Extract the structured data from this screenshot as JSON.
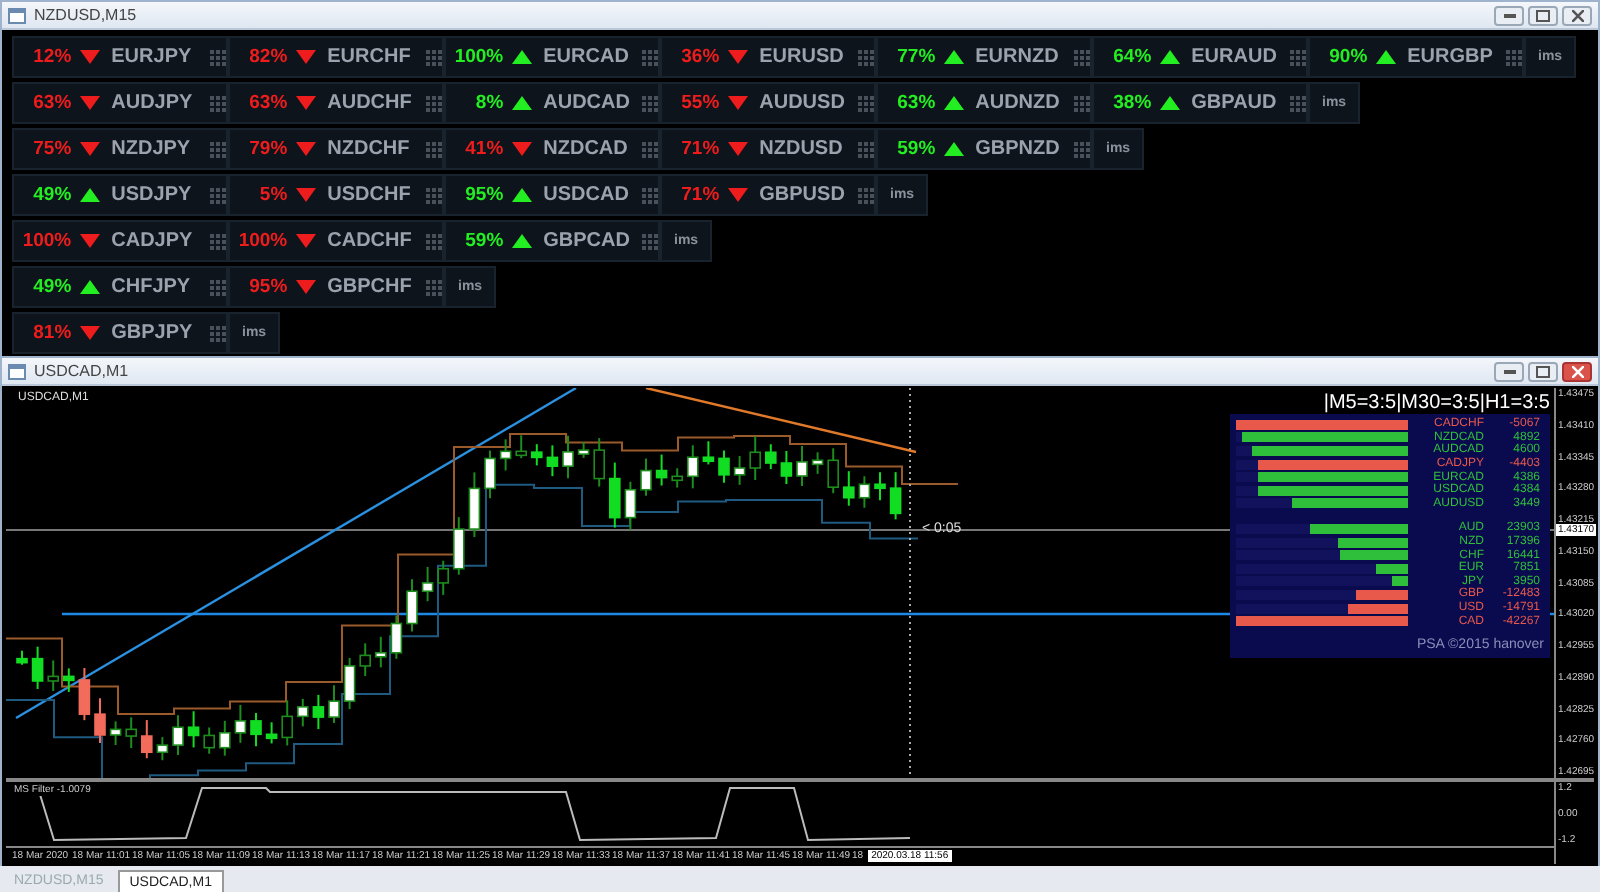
{
  "heatmap_window": {
    "title": "NZDUSD,M15",
    "rows": [
      {
        "tiles": [
          {
            "percent": "12%",
            "rising": false,
            "pair": "EURJPY"
          },
          {
            "percent": "82%",
            "rising": false,
            "pair": "EURCHF"
          },
          {
            "percent": "100%",
            "rising": true,
            "pair": "EURCAD"
          },
          {
            "percent": "36%",
            "rising": false,
            "pair": "EURUSD"
          },
          {
            "percent": "77%",
            "rising": true,
            "pair": "EURNZD"
          },
          {
            "percent": "64%",
            "rising": true,
            "pair": "EURAUD"
          },
          {
            "percent": "90%",
            "rising": true,
            "pair": "EURGBP"
          }
        ],
        "logo": "ims"
      },
      {
        "tiles": [
          {
            "percent": "63%",
            "rising": false,
            "pair": "AUDJPY"
          },
          {
            "percent": "63%",
            "rising": false,
            "pair": "AUDCHF"
          },
          {
            "percent": "8%",
            "rising": true,
            "pair": "AUDCAD"
          },
          {
            "percent": "55%",
            "rising": false,
            "pair": "AUDUSD"
          },
          {
            "percent": "63%",
            "rising": true,
            "pair": "AUDNZD"
          },
          {
            "percent": "38%",
            "rising": true,
            "pair": "GBPAUD"
          }
        ],
        "logo": "ims"
      },
      {
        "tiles": [
          {
            "percent": "75%",
            "rising": false,
            "pair": "NZDJPY"
          },
          {
            "percent": "79%",
            "rising": false,
            "pair": "NZDCHF"
          },
          {
            "percent": "41%",
            "rising": false,
            "pair": "NZDCAD"
          },
          {
            "percent": "71%",
            "rising": false,
            "pair": "NZDUSD"
          },
          {
            "percent": "59%",
            "rising": true,
            "pair": "GBPNZD"
          }
        ],
        "logo": "ims"
      },
      {
        "tiles": [
          {
            "percent": "49%",
            "rising": true,
            "pair": "USDJPY"
          },
          {
            "percent": "5%",
            "rising": false,
            "pair": "USDCHF"
          },
          {
            "percent": "95%",
            "rising": true,
            "pair": "USDCAD"
          },
          {
            "percent": "71%",
            "rising": false,
            "pair": "GBPUSD"
          }
        ],
        "logo": "ims"
      },
      {
        "tiles": [
          {
            "percent": "100%",
            "rising": false,
            "pair": "CADJPY"
          },
          {
            "percent": "100%",
            "rising": false,
            "pair": "CADCHF"
          },
          {
            "percent": "59%",
            "rising": true,
            "pair": "GBPCAD"
          }
        ],
        "logo": "ims"
      },
      {
        "tiles": [
          {
            "percent": "49%",
            "rising": true,
            "pair": "CHFJPY"
          },
          {
            "percent": "95%",
            "rising": false,
            "pair": "GBPCHF"
          }
        ],
        "logo": "ims"
      },
      {
        "tiles": [
          {
            "percent": "81%",
            "rising": false,
            "pair": "GBPJPY"
          }
        ],
        "logo": "ims"
      }
    ]
  },
  "chart_window": {
    "title": "USDCAD,M1",
    "symbol_label": "USDCAD,M1",
    "timer": "< 0:05",
    "price_axis": [
      "1.43475",
      "1.43410",
      "1.43345",
      "1.43280",
      "1.43215",
      "1.43150",
      "1.43085",
      "1.43020",
      "1.42955",
      "1.42890",
      "1.42825",
      "1.42760",
      "1.42695"
    ],
    "current_price": "1.43170",
    "strength_panel": {
      "title": "|M5=3:5|M30=3:5|H1=3:5",
      "pairs": [
        {
          "name": "CADCHF",
          "value": "-5067",
          "level": 1,
          "color": "#e8594b"
        },
        {
          "name": "NZDCAD",
          "value": "4892",
          "level": 0.97,
          "color": "#2fbf3a"
        },
        {
          "name": "AUDCAD",
          "value": "4600",
          "level": 0.91,
          "color": "#2fbf3a"
        },
        {
          "name": "CADJPY",
          "value": "-4403",
          "level": 0.87,
          "color": "#e8594b"
        },
        {
          "name": "EURCAD",
          "value": "4386",
          "level": 0.87,
          "color": "#2fbf3a"
        },
        {
          "name": "USDCAD",
          "value": "4384",
          "level": 0.87,
          "color": "#2fbf3a"
        },
        {
          "name": "AUDUSD",
          "value": "3449",
          "level": 0.68,
          "color": "#2fbf3a"
        }
      ],
      "currencies": [
        {
          "name": "AUD",
          "value": "23903",
          "level": 0.57,
          "color": "#2fbf3a"
        },
        {
          "name": "NZD",
          "value": "17396",
          "level": 0.41,
          "color": "#2fbf3a"
        },
        {
          "name": "CHF",
          "value": "16441",
          "level": 0.39,
          "color": "#2fbf3a"
        },
        {
          "name": "EUR",
          "value": "7851",
          "level": 0.19,
          "color": "#2fbf3a"
        },
        {
          "name": "JPY",
          "value": "3950",
          "level": 0.09,
          "color": "#2fbf3a"
        },
        {
          "name": "GBP",
          "value": "-12483",
          "level": 0.3,
          "color": "#e8594b"
        },
        {
          "name": "USD",
          "value": "-14791",
          "level": 0.35,
          "color": "#e8594b"
        },
        {
          "name": "CAD",
          "value": "-42267",
          "level": 1,
          "color": "#e8594b"
        }
      ],
      "footer": "PSA ©2015 hanover"
    },
    "indicator": {
      "label": "MS Filter -1.0079",
      "axis": [
        "1.2",
        "0.00",
        "-1.2"
      ]
    },
    "time_axis": [
      "18 Mar 2020",
      "18 Mar 11:01",
      "18 Mar 11:05",
      "18 Mar 11:09",
      "18 Mar 11:13",
      "18 Mar 11:17",
      "18 Mar 11:21",
      "18 Mar 11:25",
      "18 Mar 11:29",
      "18 Mar 11:33",
      "18 Mar 11:37",
      "18 Mar 11:41",
      "18 Mar 11:45",
      "18 Mar 11:49",
      "18"
    ],
    "time_cursor": "2020.03.18 11:56"
  },
  "tabs": [
    {
      "label": "NZDUSD,M15",
      "selected": false
    },
    {
      "label": "USDCAD,M1",
      "selected": true
    }
  ]
}
